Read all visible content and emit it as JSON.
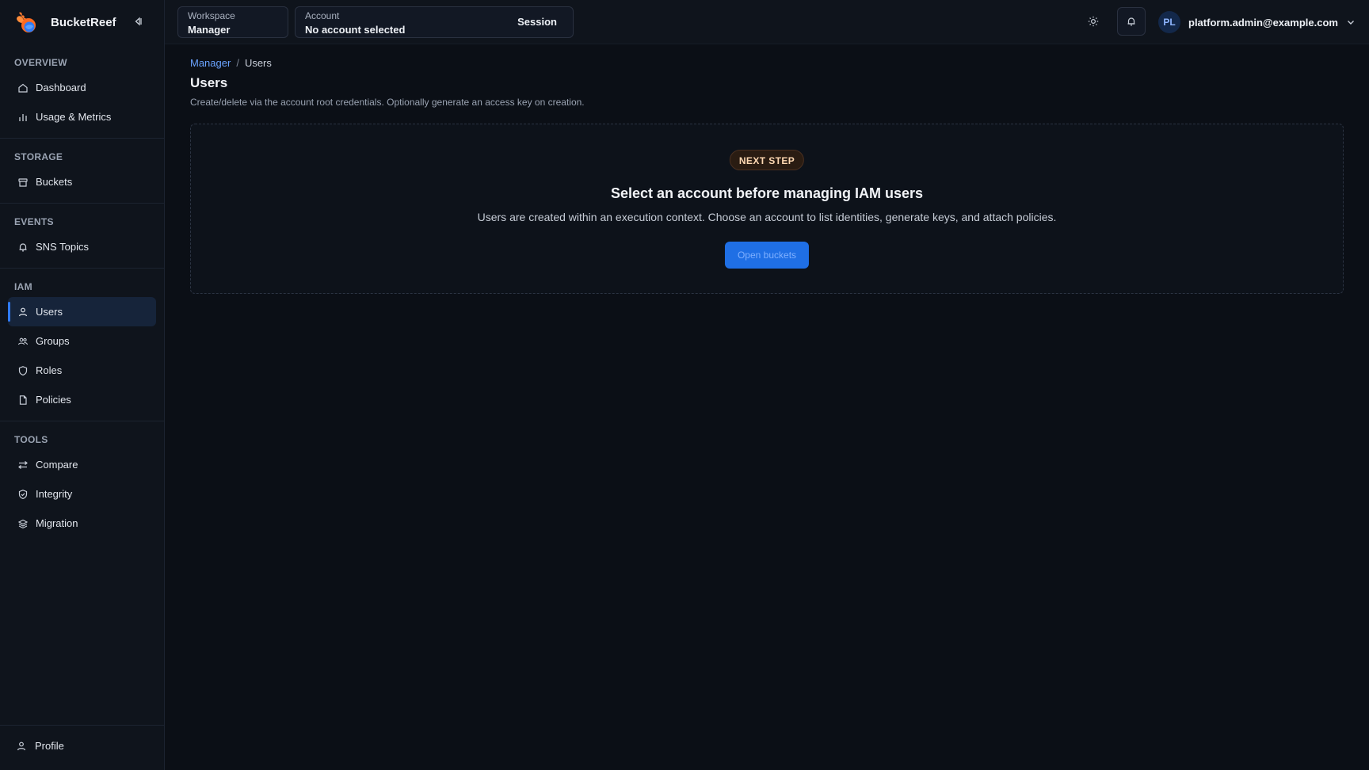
{
  "app": {
    "name": "BucketReef"
  },
  "sidebar": {
    "sections": [
      {
        "title": "OVERVIEW",
        "items": [
          {
            "label": "Dashboard",
            "icon": "home-icon"
          },
          {
            "label": "Usage & Metrics",
            "icon": "bar-chart-icon"
          }
        ]
      },
      {
        "title": "STORAGE",
        "items": [
          {
            "label": "Buckets",
            "icon": "bucket-icon"
          }
        ]
      },
      {
        "title": "EVENTS",
        "items": [
          {
            "label": "SNS Topics",
            "icon": "bell-icon"
          }
        ]
      },
      {
        "title": "IAM",
        "items": [
          {
            "label": "Users",
            "icon": "user-icon",
            "active": true
          },
          {
            "label": "Groups",
            "icon": "users-icon"
          },
          {
            "label": "Roles",
            "icon": "shield-icon"
          },
          {
            "label": "Policies",
            "icon": "document-icon"
          }
        ]
      },
      {
        "title": "TOOLS",
        "items": [
          {
            "label": "Compare",
            "icon": "compare-icon"
          },
          {
            "label": "Integrity",
            "icon": "shield-check-icon"
          },
          {
            "label": "Migration",
            "icon": "migration-icon"
          }
        ]
      }
    ],
    "profile_label": "Profile"
  },
  "topbar": {
    "workspace": {
      "label": "Workspace",
      "value": "Manager"
    },
    "account": {
      "label": "Account",
      "value": "No account selected"
    },
    "session_label": "Session",
    "user": {
      "initials": "PL",
      "email": "platform.admin@example.com"
    }
  },
  "breadcrumb": {
    "parent": "Manager",
    "separator": "/",
    "current": "Users"
  },
  "page": {
    "title": "Users",
    "description": "Create/delete via the account root credentials. Optionally generate an access key on creation."
  },
  "empty_state": {
    "badge": "NEXT STEP",
    "title": "Select an account before managing IAM users",
    "description": "Users are created within an execution context. Choose an account to list identities, generate keys, and attach policies.",
    "button_label": "Open buckets"
  },
  "colors": {
    "accent": "#2f7bf5",
    "background": "#0b0f16",
    "sidebar": "#0f141c",
    "badge": "#2a1c12"
  }
}
